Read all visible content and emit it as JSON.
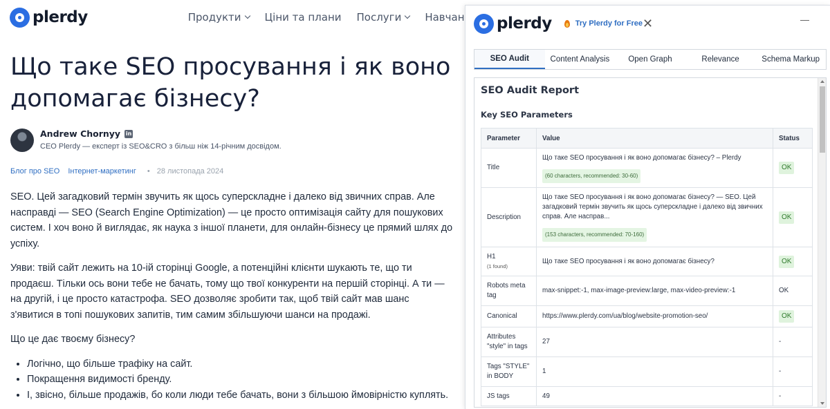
{
  "site": {
    "logo_text": "plerdy",
    "nav": [
      {
        "label": "Продукти"
      },
      {
        "label": "Ціни та плани"
      },
      {
        "label": "Послуги"
      },
      {
        "label": "Навчання"
      }
    ]
  },
  "article": {
    "title": "Що таке SEO просування і як воно допомагає бізнесу?",
    "author_name": "Andrew Chornyy",
    "author_desc": "CEO Plerdy — експерт із SEO&CRO з більш ніж 14-річним досвідом.",
    "tag1": "Блог про SEO",
    "tag2": "Інтернет-маркетинг",
    "date": "28 листопада 2024",
    "para1": "SEO. Цей загадковий термін звучить як щось суперскладне і далеко від звичних справ. Але насправді — SEO (Search Engine Optimization) — це просто оптимізація сайту для пошукових систем. І хоч воно й виглядає, як наука з іншої планети, для онлайн-бізнесу це прямий шлях до успіху.",
    "para2": "Уяви: твій сайт лежить на 10-ій сторінці Google, а потенційні клієнти шукають те, що ти продаєш. Тільки ось вони тебе не бачать, тому що твої конкуренти на першій сторінці. А ти — на другій, і це просто катастрофа. SEO дозволяє зробити так, щоб твій сайт мав шанс з'явитися в топі пошукових запитів, тим самим збільшуючи шанси на продажі.",
    "para3": "Що це дає твоєму бізнесу?",
    "list": [
      "Логічно, що більше трафіку на сайт.",
      "Покращення видимості бренду.",
      "І, звісно, більше продажів, бо коли люди тебе бачать, вони з більшою ймовірністю куплять."
    ]
  },
  "panel": {
    "logo_text": "plerdy",
    "try_free": "Try Plerdy for Free",
    "tabs": [
      "SEO Audit",
      "Content Analysis",
      "Open Graph",
      "Relevance",
      "Schema Markup"
    ],
    "report_title": "SEO Audit Report",
    "section_title": "Key SEO Parameters",
    "table": {
      "headers": [
        "Parameter",
        "Value",
        "Status"
      ],
      "title_row": {
        "param": "Title",
        "value": "Що таке SEO просування і як воно допомагає бізнесу? – Plerdy",
        "hint": "(60 characters, recommended: 30-60)",
        "status": "OK"
      },
      "description_row": {
        "param": "Description",
        "value": "Що таке SEO просування і як воно допомагає бізнесу? — SEO. Цей загадковий термін звучить як щось суперскладне і далеко від звичних справ. Але насправ...",
        "hint": "(153 characters, recommended: 70-160)",
        "status": "OK"
      },
      "h1_row": {
        "param": "H1",
        "note": "(1 found)",
        "value": "Що таке SEO просування і як воно допомагає бізнесу?",
        "status": "OK"
      },
      "robots_row": {
        "param": "Robots meta tag",
        "value": "max-snippet:-1, max-image-preview:large, max-video-preview:-1",
        "status": "OK"
      },
      "canonical_row": {
        "param": "Canonical",
        "value": "https://www.plerdy.com/ua/blog/website-promotion-seo/",
        "status": "OK"
      },
      "style_attr_row": {
        "param": "Attributes \"style\" in tags",
        "value": "27",
        "status": "-"
      },
      "style_tags_row": {
        "param": "Tags \"STYLE\" in BODY",
        "value": "1",
        "status": "-"
      },
      "js_row": {
        "param": "JS tags",
        "value": "49",
        "status": "-"
      }
    }
  }
}
